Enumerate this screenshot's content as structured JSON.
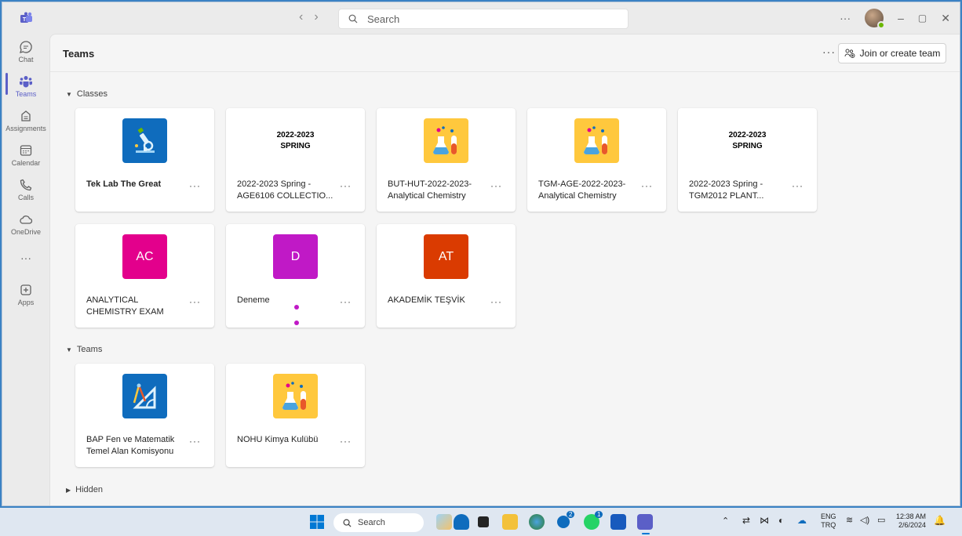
{
  "titlebar": {
    "search_placeholder": "Search",
    "more": "···"
  },
  "rail": [
    {
      "label": "Chat",
      "icon": "chat-icon"
    },
    {
      "label": "Teams",
      "icon": "teams-icon",
      "active": true
    },
    {
      "label": "Assignments",
      "icon": "assignments-icon"
    },
    {
      "label": "Calendar",
      "icon": "calendar-icon"
    },
    {
      "label": "Calls",
      "icon": "calls-icon"
    },
    {
      "label": "OneDrive",
      "icon": "onedrive-icon"
    },
    {
      "label": "···",
      "icon": "more-apps-icon"
    },
    {
      "label": "Apps",
      "icon": "apps-icon"
    }
  ],
  "header": {
    "title": "Teams",
    "more": "···",
    "join_label": "Join or create team"
  },
  "sections": {
    "classes": "Classes",
    "teams": "Teams",
    "hidden": "Hidden"
  },
  "classes": [
    {
      "name": "Tek Lab The Great",
      "bold": true,
      "img": "microscope-icon"
    },
    {
      "name": "2022-2023 Spring - AGE6106 COLLECTIO...",
      "img_text": "2022-2023 SPRING"
    },
    {
      "name": "BUT-HUT-2022-2023-Analytical Chemistry",
      "img": "chemistry-flask-icon"
    },
    {
      "name": "TGM-AGE-2022-2023-Analytical Chemistry",
      "img": "chemistry-flask-icon"
    },
    {
      "name": "2022-2023 Spring - TGM2012 PLANT...",
      "img_text": "2022-2023 SPRING"
    },
    {
      "name": "ANALYTICAL CHEMISTRY EXAM",
      "initials": "AC",
      "color": "#e3008c"
    },
    {
      "name": "Deneme",
      "initials": "D",
      "color": "#c019c6"
    },
    {
      "name": "AKADEMİK TEŞVİK",
      "initials": "AT",
      "color": "#da3b01"
    }
  ],
  "teams": [
    {
      "name": "BAP Fen ve Matematik Temel Alan Komisyonu",
      "img": "geometry-tools-icon"
    },
    {
      "name": "NOHU Kimya Kulübü",
      "img": "chemistry-flask-icon"
    }
  ],
  "card_more": "···",
  "taskbar": {
    "search": "Search",
    "lang1": "ENG",
    "lang2": "TRQ",
    "time": "12:38 AM",
    "date": "2/6/2024",
    "badge1": "2",
    "badge2": "1"
  },
  "colors": {
    "accent": "#5b5fc7",
    "microscope_bg": "#0f6cbd",
    "flask_bg": "#ffc83d"
  }
}
